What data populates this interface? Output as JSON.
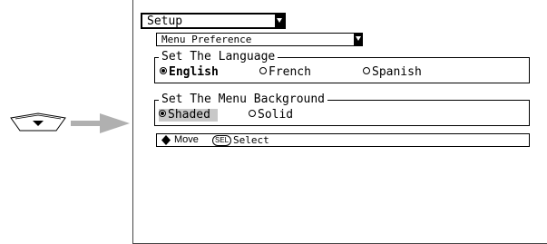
{
  "setup": {
    "label": "Setup"
  },
  "menu_preference": {
    "label": "Menu Preference"
  },
  "language_group": {
    "legend": "Set The Language",
    "options": [
      "English",
      "French",
      "Spanish"
    ],
    "selected": "English"
  },
  "background_group": {
    "legend": "Set The Menu Background",
    "options": [
      "Shaded",
      "Solid"
    ],
    "selected": "Shaded"
  },
  "statusbar": {
    "move_label": "Move",
    "sel_key": "SEL",
    "select_label": "Select"
  },
  "icons": {
    "remote_button": "down-triangle-button-icon",
    "pointer_arrow": "right-arrow-icon",
    "move_icon": "four-way-diamond-icon"
  }
}
